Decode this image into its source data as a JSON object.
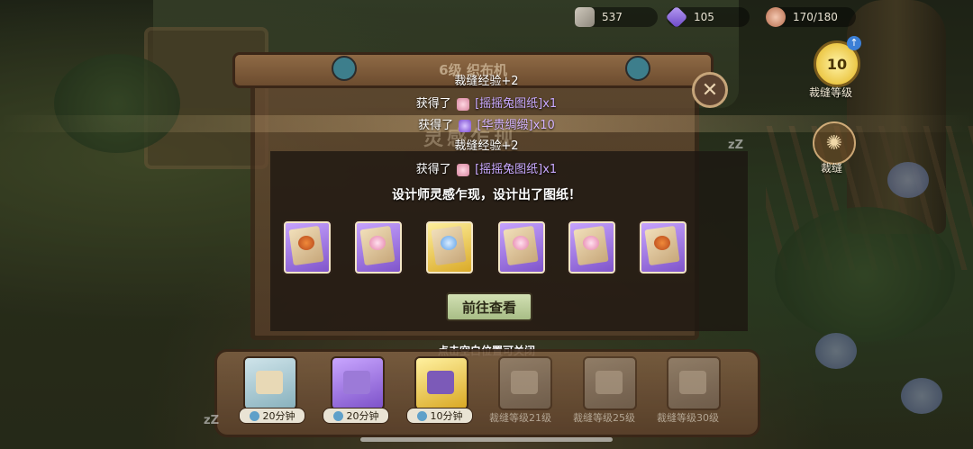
{
  "resources": [
    {
      "icon": "gear-material-icon",
      "value": "537"
    },
    {
      "icon": "purple-crystal-icon",
      "value": "105"
    },
    {
      "icon": "house-capacity-icon",
      "value": "170/180"
    }
  ],
  "side": {
    "level_value": "10",
    "level_label": "裁缝等级",
    "tailor_label": "裁缝"
  },
  "panel": {
    "title": "6级 织布机",
    "subtitle": "灵感乍现"
  },
  "log": [
    {
      "prefix": "裁缝经验+2",
      "item": "",
      "suffix": ""
    },
    {
      "prefix": "获得了",
      "item": "[摇摇兔图纸]",
      "suffix": "x1",
      "icon": "pink"
    },
    {
      "prefix": "获得了",
      "item": "[华贵绸缎]",
      "suffix": "x10",
      "icon": "violet"
    },
    {
      "prefix": "裁缝经验+2",
      "item": "",
      "suffix": ""
    },
    {
      "prefix": "获得了",
      "item": "[摇摇兔图纸]",
      "suffix": "x1",
      "icon": "pink"
    }
  ],
  "headline": "设计师灵感乍现，设计出了图纸！",
  "cards": [
    {
      "rarity": "purple",
      "motif": "carrot"
    },
    {
      "rarity": "purple",
      "motif": "rabbit"
    },
    {
      "rarity": "gold",
      "motif": "blue"
    },
    {
      "rarity": "purple",
      "motif": "rabbit"
    },
    {
      "rarity": "purple",
      "motif": "rabbit"
    },
    {
      "rarity": "purple",
      "motif": "carrot"
    }
  ],
  "view_button": "前往查看",
  "close_hint": "点击空白位置可关闭",
  "slots": [
    {
      "state": "timer",
      "text": "20分钟"
    },
    {
      "state": "timer",
      "text": "20分钟"
    },
    {
      "state": "timer",
      "text": "10分钟"
    },
    {
      "state": "locked",
      "text": "裁缝等级21级"
    },
    {
      "state": "locked",
      "text": "裁缝等级25级"
    },
    {
      "state": "locked",
      "text": "裁缝等级30级"
    }
  ],
  "colors": {
    "gold": "#d9a824",
    "purple": "#7d52c9",
    "accent_button": "#a8bd86"
  }
}
